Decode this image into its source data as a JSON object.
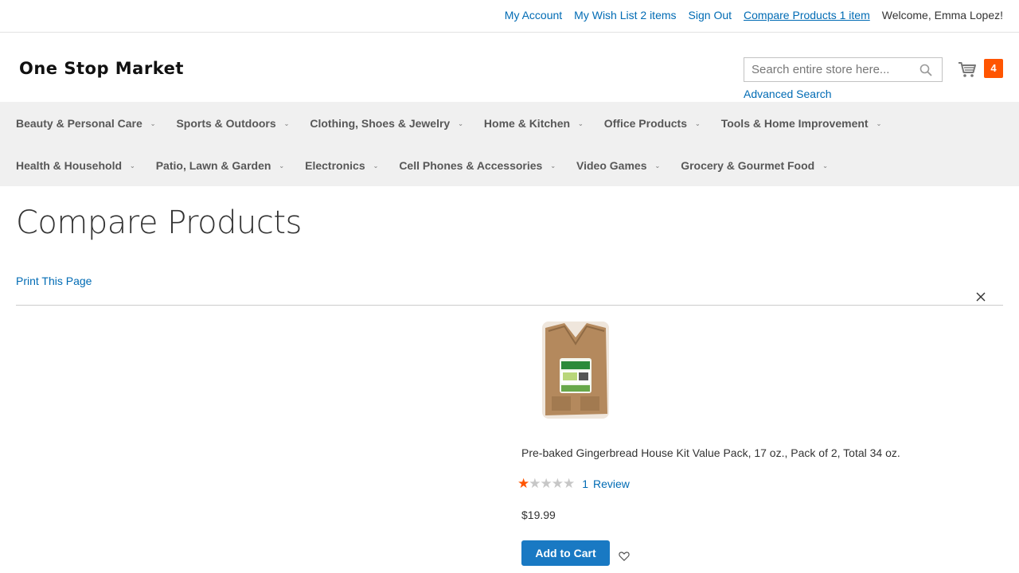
{
  "header": {
    "links": {
      "my_account": "My Account",
      "wishlist": "My Wish List 2 items",
      "sign_out": "Sign Out",
      "compare": "Compare Products 1 item",
      "welcome": "Welcome, Emma Lopez!"
    },
    "logo_text": "One Stop Market",
    "search": {
      "placeholder": "Search entire store here..."
    },
    "advanced_search": "Advanced Search",
    "cart_count": "4"
  },
  "nav": {
    "row1": [
      "Beauty & Personal Care",
      "Sports & Outdoors",
      "Clothing, Shoes & Jewelry",
      "Home & Kitchen",
      "Office Products",
      "Tools & Home Improvement"
    ],
    "row2": [
      "Health & Household",
      "Patio, Lawn & Garden",
      "Electronics",
      "Cell Phones & Accessories",
      "Video Games",
      "Grocery & Gourmet Food"
    ]
  },
  "main": {
    "title": "Compare Products",
    "print": "Print This Page",
    "product": {
      "name": "Pre-baked Gingerbread House Kit Value Pack, 17 oz., Pack of 2, Total 34 oz.",
      "rating_stars": 1,
      "rating_max": 5,
      "review_count": "1",
      "review_label": "Review",
      "price": "$19.99",
      "add_to_cart": "Add to Cart"
    }
  },
  "colors": {
    "link": "#006bb4",
    "accent": "#ff5501",
    "button": "#1979c3"
  }
}
